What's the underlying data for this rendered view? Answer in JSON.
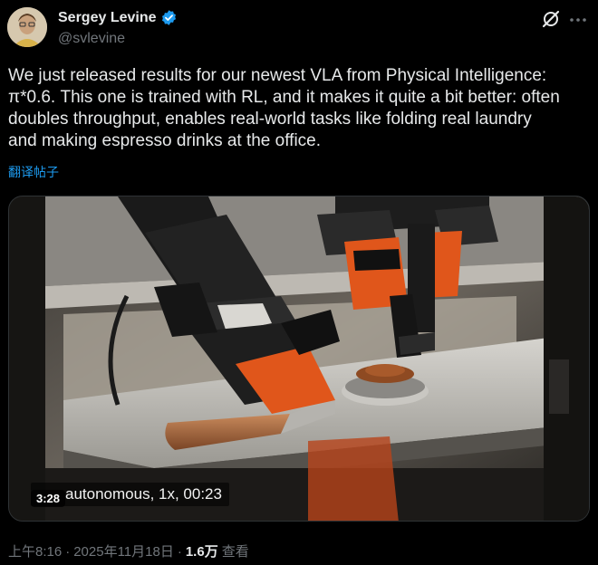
{
  "author": {
    "name": "Sergey Levine",
    "handle": "@svlevine",
    "verified": true
  },
  "tweet": {
    "text": "We just released results for our newest VLA from Physical Intelligence:\nπ*0.6. This one is trained with RL, and it makes it quite a bit better: often\ndoubles throughput, enables real-world tasks like folding real laundry\nand making espresso drinks at the office.",
    "translate_label": "翻译帖子"
  },
  "media": {
    "caption": "autonomous, 1x, 00:23",
    "duration": "3:28"
  },
  "meta": {
    "time": "上午8:16",
    "separator": "·",
    "date": "2025年11月18日",
    "views_count": "1.6万",
    "views_label": "查看"
  },
  "colors": {
    "accent": "#1d9bf0",
    "verified": "#1d9bf0",
    "secondary_text": "#71767b",
    "robot_orange": "#e0561b"
  },
  "icons": {
    "grok": "grok-icon",
    "more": "more-icon",
    "verified": "verified-badge-icon"
  }
}
